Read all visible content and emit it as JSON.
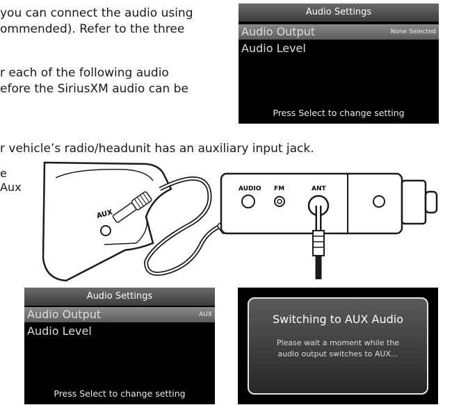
{
  "intro_text": {
    "line1": "you can connect the audio using",
    "line2": "ommended). Refer to the three",
    "line3": "r each of the following audio",
    "line4": "efore the SiriusXM audio can be",
    "line5": "r vehicle’s radio/headunit has an auxiliary input jack.",
    "line6": "e",
    "line7": "Aux"
  },
  "screen_top": {
    "title": "Audio Settings",
    "rows": [
      {
        "label": "Audio Output",
        "value": "None Selected"
      },
      {
        "label": "Audio Level",
        "value": ""
      }
    ],
    "footer": "Press Select to change setting"
  },
  "screen_bottom_left": {
    "title": "Audio Settings",
    "rows": [
      {
        "label": "Audio Output",
        "value": "AUX"
      },
      {
        "label": "Audio Level",
        "value": ""
      }
    ],
    "footer": "Press Select to change setting"
  },
  "popup": {
    "title": "Switching to AUX Audio",
    "message_line1": "Please wait a moment while the",
    "message_line2": "audio output switches to AUX..."
  },
  "diagram": {
    "aux_label": "AUX",
    "audio_label": "AUDIO",
    "fm_label": "FM",
    "ant_label": "ANT"
  }
}
